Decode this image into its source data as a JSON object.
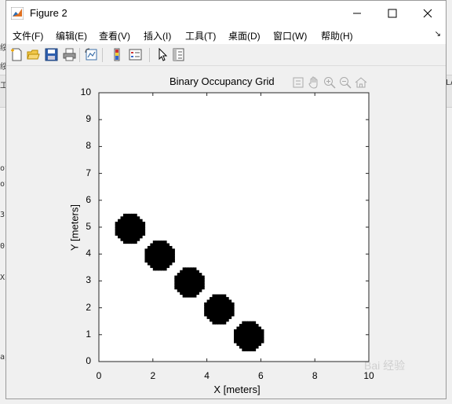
{
  "window": {
    "title": "Figure 2"
  },
  "menu": [
    "文件(F)",
    "编辑(E)",
    "查看(V)",
    "插入(I)",
    "工具(T)",
    "桌面(D)",
    "窗口(W)",
    "帮助(H)"
  ],
  "menu_overflow": "↘",
  "toolbar": [
    "new-figure",
    "open-file",
    "save",
    "print",
    "link-plot",
    "insert-colorbar",
    "insert-legend",
    "edit-plot",
    "property-inspector"
  ],
  "axes_toolbar": [
    "restore-view",
    "pan",
    "zoom-in",
    "zoom-out",
    "home"
  ],
  "background_fragments": [
    "绥",
    "绥",
    "工",
    "ot",
    "ot",
    "3 ;",
    "0 ;",
    "Xn",
    "ap"
  ],
  "background_right_fragment": "LA",
  "watermark": "Bai 经验",
  "chart_data": {
    "type": "scatter",
    "title": "Binary Occupancy Grid",
    "xlabel": "X [meters]",
    "ylabel": "Y [meters]",
    "xlim": [
      0,
      10
    ],
    "ylim": [
      0,
      10
    ],
    "xticks": [
      0,
      2,
      4,
      6,
      8,
      10
    ],
    "yticks": [
      0,
      1,
      2,
      3,
      4,
      5,
      6,
      7,
      8,
      9,
      10
    ],
    "grid": false,
    "marker_color": "#000000",
    "marker_shape": "filled pixelated disc",
    "points": [
      {
        "x": 1.15,
        "y": 4.95
      },
      {
        "x": 2.25,
        "y": 3.95
      },
      {
        "x": 3.35,
        "y": 2.95
      },
      {
        "x": 4.45,
        "y": 1.95
      },
      {
        "x": 5.55,
        "y": 0.95
      }
    ],
    "point_radius": 0.55
  }
}
